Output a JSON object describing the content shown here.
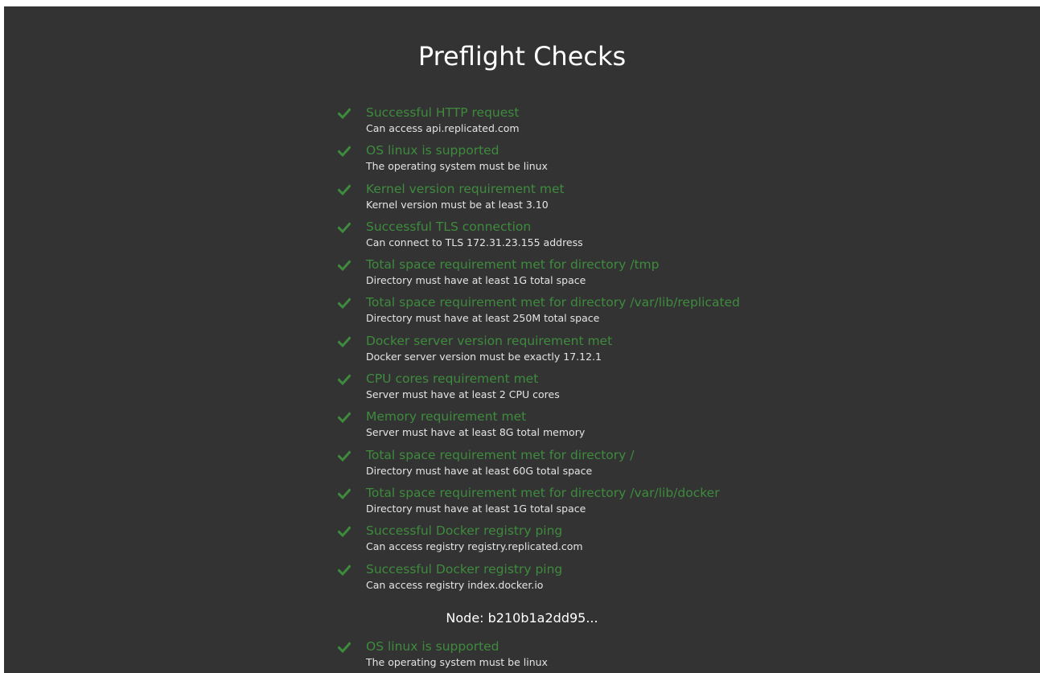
{
  "title": "Preflight Checks",
  "colors": {
    "background": "#333333",
    "success": "#3e8b3e",
    "text": "#e4e4e4"
  },
  "checks": [
    {
      "title": "Successful HTTP request",
      "description": "Can access api.replicated.com",
      "icon": "check-icon"
    },
    {
      "title": "OS linux is supported",
      "description": "The operating system must be linux",
      "icon": "check-icon"
    },
    {
      "title": "Kernel version requirement met",
      "description": "Kernel version must be at least 3.10",
      "icon": "check-icon"
    },
    {
      "title": "Successful TLS connection",
      "description": "Can connect to TLS 172.31.23.155 address",
      "icon": "check-icon"
    },
    {
      "title": "Total space requirement met for directory /tmp",
      "description": "Directory must have at least 1G total space",
      "icon": "check-icon"
    },
    {
      "title": "Total space requirement met for directory /var/lib/replicated",
      "description": "Directory must have at least 250M total space",
      "icon": "check-icon"
    },
    {
      "title": "Docker server version requirement met",
      "description": "Docker server version must be exactly 17.12.1",
      "icon": "check-icon"
    },
    {
      "title": "CPU cores requirement met",
      "description": "Server must have at least 2 CPU cores",
      "icon": "check-icon"
    },
    {
      "title": "Memory requirement met",
      "description": "Server must have at least 8G total memory",
      "icon": "check-icon"
    },
    {
      "title": "Total space requirement met for directory /",
      "description": "Directory must have at least 60G total space",
      "icon": "check-icon"
    },
    {
      "title": "Total space requirement met for directory /var/lib/docker",
      "description": "Directory must have at least 1G total space",
      "icon": "check-icon"
    },
    {
      "title": "Successful Docker registry ping",
      "description": "Can access registry registry.replicated.com",
      "icon": "check-icon"
    },
    {
      "title": "Successful Docker registry ping",
      "description": "Can access registry index.docker.io",
      "icon": "check-icon"
    }
  ],
  "node": {
    "heading": "Node: b210b1a2dd95...",
    "checks": [
      {
        "title": "OS linux is supported",
        "description": "The operating system must be linux",
        "icon": "check-icon"
      }
    ]
  }
}
